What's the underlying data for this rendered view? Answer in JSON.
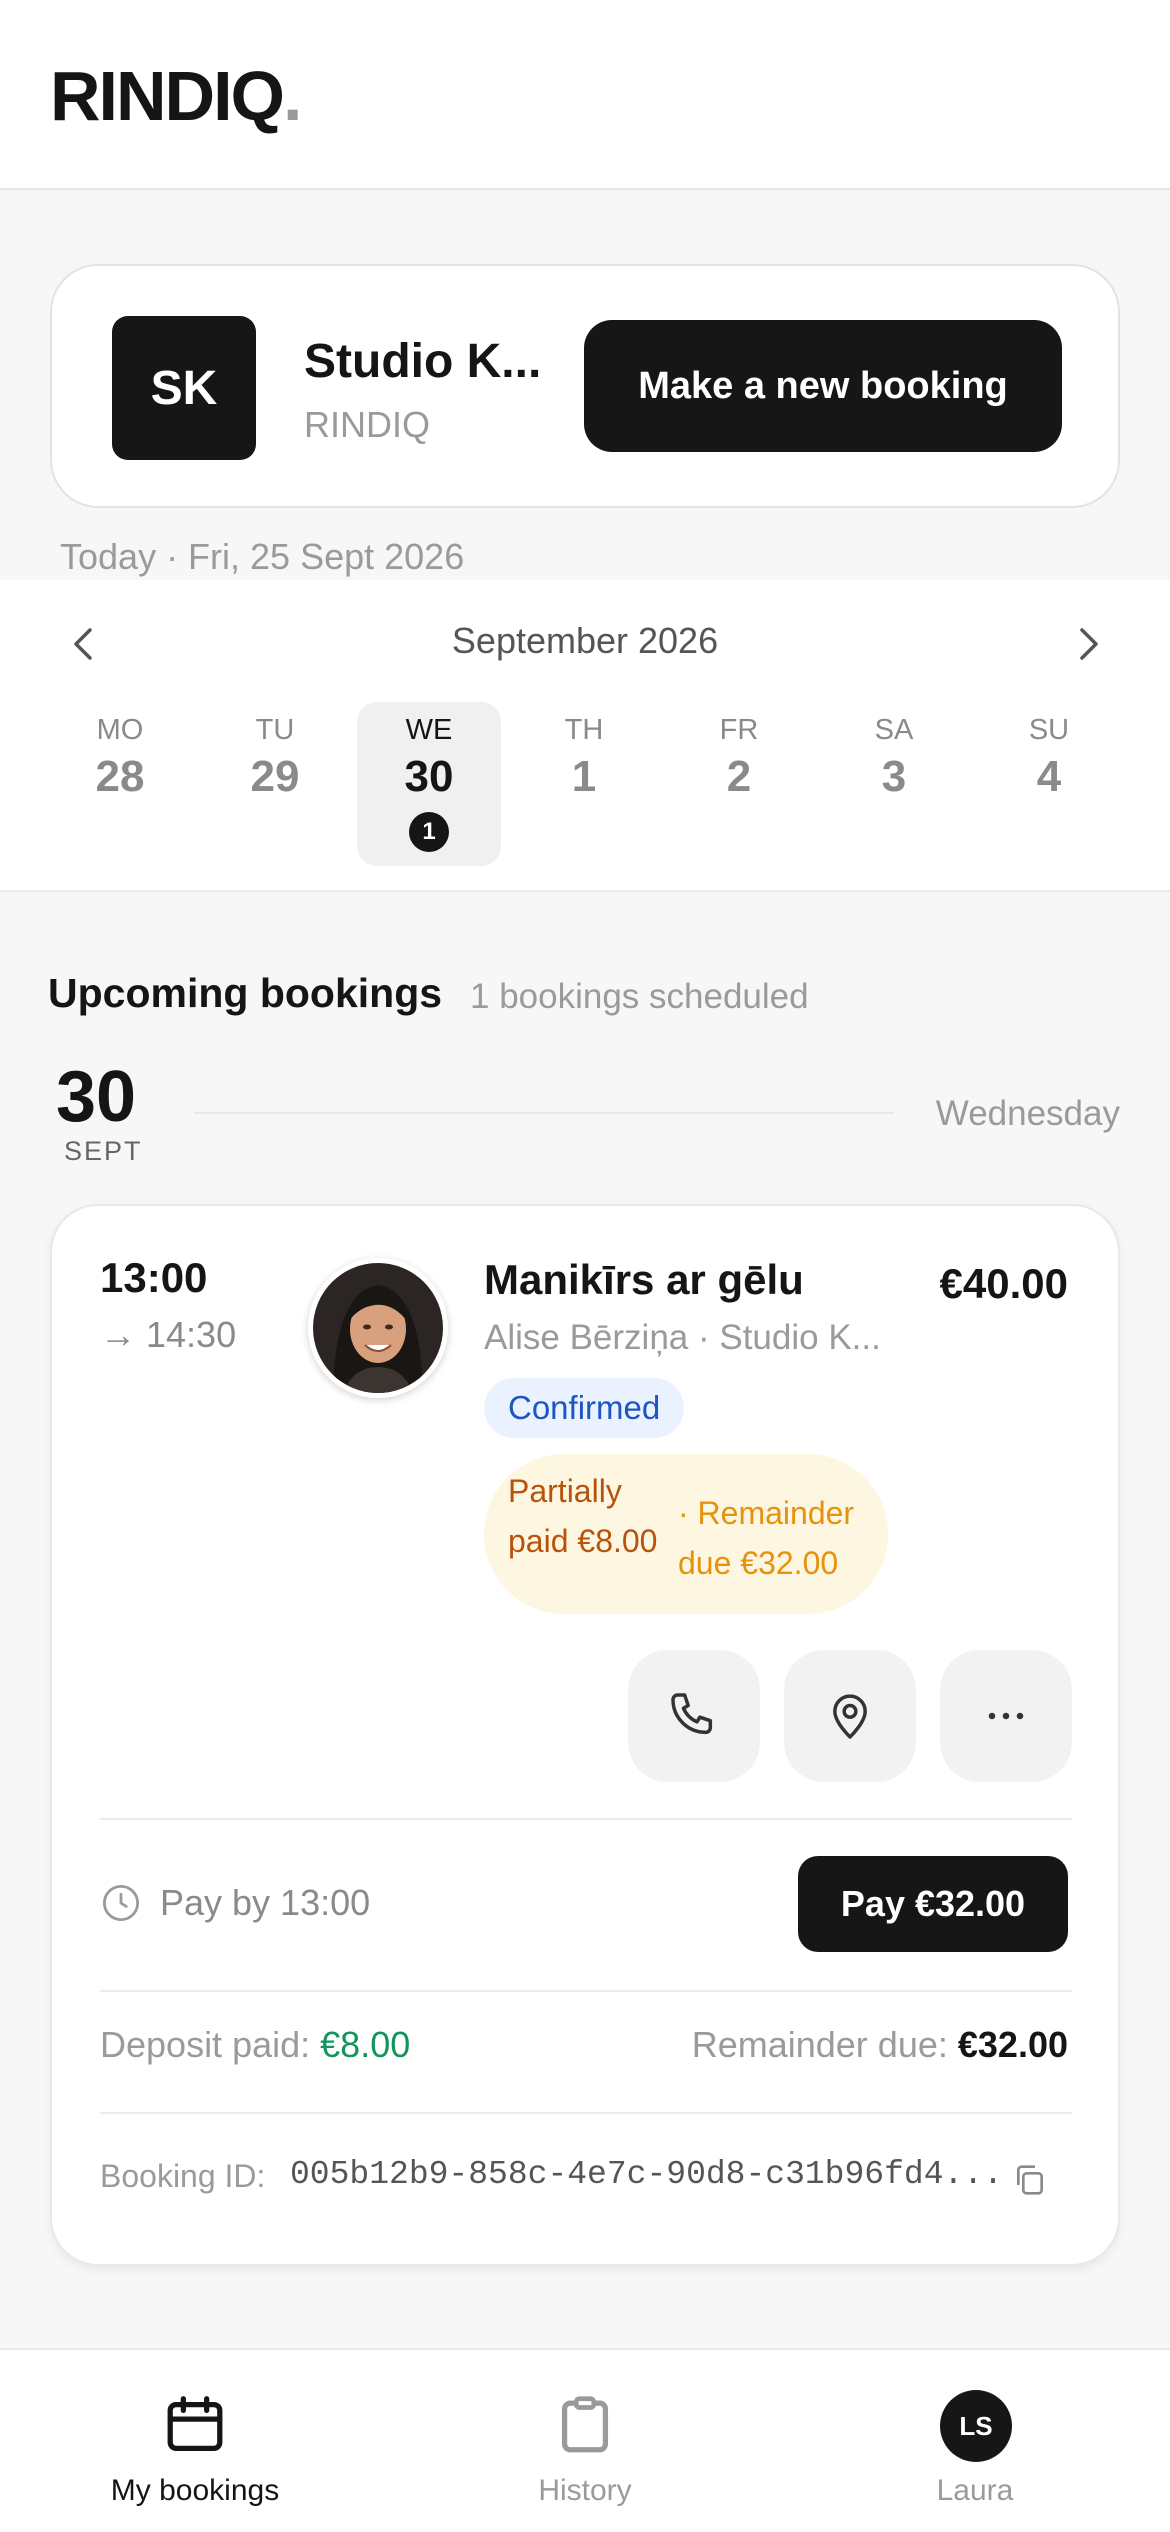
{
  "header": {
    "logo_text": "RINDIQ",
    "logo_dot": "."
  },
  "studio": {
    "initials": "SK",
    "name": "Studio K...",
    "subtitle": "RINDIQ",
    "new_booking_label": "Make a new booking"
  },
  "today_text": "Today · Fri, 25 Sept 2026",
  "calendar": {
    "month": "September 2026",
    "days": [
      {
        "abbr": "MO",
        "num": "28"
      },
      {
        "abbr": "TU",
        "num": "29"
      },
      {
        "abbr": "WE",
        "num": "30",
        "badge": "1",
        "selected": true
      },
      {
        "abbr": "TH",
        "num": "1"
      },
      {
        "abbr": "FR",
        "num": "2"
      },
      {
        "abbr": "SA",
        "num": "3"
      },
      {
        "abbr": "SU",
        "num": "4"
      }
    ]
  },
  "upcoming": {
    "title": "Upcoming bookings",
    "count_text": "1 bookings scheduled",
    "date_day": "30",
    "date_month": "SEPT",
    "weekday": "Wednesday"
  },
  "booking": {
    "start": "13:00",
    "end": "→ 14:30",
    "service": "Manikīrs ar gēlu",
    "price": "€40.00",
    "client": "Alise Bērziņa · Studio K...",
    "status": "Confirmed",
    "payment_left": "Partially paid €8.00",
    "payment_right": "· Remainder due €32.00",
    "pay_by": "Pay by 13:00",
    "pay_button": "Pay €32.00",
    "deposit_label": "Deposit paid:",
    "deposit_value": "€8.00",
    "remainder_label": "Remainder due:",
    "remainder_value": "€32.00",
    "id_label": "Booking ID:",
    "id_value": "005b12b9-858c-4e7c-90d8-c31b96fd4..."
  },
  "tabs": [
    {
      "label": "My bookings",
      "icon": "calendar-icon",
      "active": true
    },
    {
      "label": "History",
      "icon": "clipboard-icon",
      "active": false
    },
    {
      "label": "Laura",
      "avatar": "LS",
      "active": false
    }
  ],
  "colors": {
    "primary": "#161616",
    "status_blue": "#1d55c4",
    "partial_orange": "#b8530c",
    "remainder_orange": "#e6920d",
    "deposit_green": "#12955b"
  }
}
